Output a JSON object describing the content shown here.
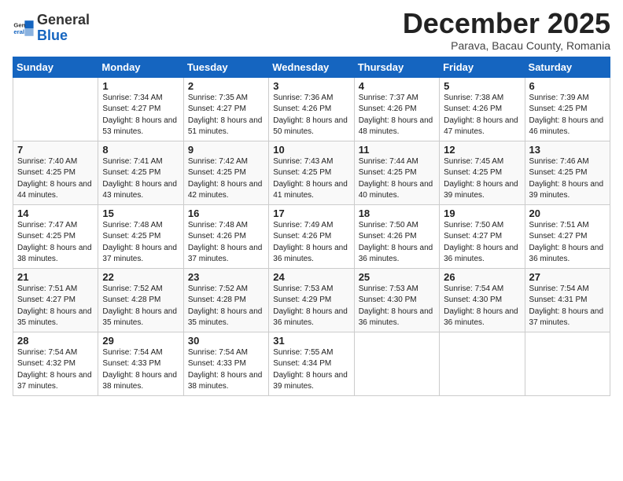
{
  "logo": {
    "general": "General",
    "blue": "Blue"
  },
  "header": {
    "month": "December 2025",
    "location": "Parava, Bacau County, Romania"
  },
  "weekdays": [
    "Sunday",
    "Monday",
    "Tuesday",
    "Wednesday",
    "Thursday",
    "Friday",
    "Saturday"
  ],
  "weeks": [
    [
      {
        "day": "",
        "sunrise": "",
        "sunset": "",
        "daylight": ""
      },
      {
        "day": "1",
        "sunrise": "Sunrise: 7:34 AM",
        "sunset": "Sunset: 4:27 PM",
        "daylight": "Daylight: 8 hours and 53 minutes."
      },
      {
        "day": "2",
        "sunrise": "Sunrise: 7:35 AM",
        "sunset": "Sunset: 4:27 PM",
        "daylight": "Daylight: 8 hours and 51 minutes."
      },
      {
        "day": "3",
        "sunrise": "Sunrise: 7:36 AM",
        "sunset": "Sunset: 4:26 PM",
        "daylight": "Daylight: 8 hours and 50 minutes."
      },
      {
        "day": "4",
        "sunrise": "Sunrise: 7:37 AM",
        "sunset": "Sunset: 4:26 PM",
        "daylight": "Daylight: 8 hours and 48 minutes."
      },
      {
        "day": "5",
        "sunrise": "Sunrise: 7:38 AM",
        "sunset": "Sunset: 4:26 PM",
        "daylight": "Daylight: 8 hours and 47 minutes."
      },
      {
        "day": "6",
        "sunrise": "Sunrise: 7:39 AM",
        "sunset": "Sunset: 4:25 PM",
        "daylight": "Daylight: 8 hours and 46 minutes."
      }
    ],
    [
      {
        "day": "7",
        "sunrise": "Sunrise: 7:40 AM",
        "sunset": "Sunset: 4:25 PM",
        "daylight": "Daylight: 8 hours and 44 minutes."
      },
      {
        "day": "8",
        "sunrise": "Sunrise: 7:41 AM",
        "sunset": "Sunset: 4:25 PM",
        "daylight": "Daylight: 8 hours and 43 minutes."
      },
      {
        "day": "9",
        "sunrise": "Sunrise: 7:42 AM",
        "sunset": "Sunset: 4:25 PM",
        "daylight": "Daylight: 8 hours and 42 minutes."
      },
      {
        "day": "10",
        "sunrise": "Sunrise: 7:43 AM",
        "sunset": "Sunset: 4:25 PM",
        "daylight": "Daylight: 8 hours and 41 minutes."
      },
      {
        "day": "11",
        "sunrise": "Sunrise: 7:44 AM",
        "sunset": "Sunset: 4:25 PM",
        "daylight": "Daylight: 8 hours and 40 minutes."
      },
      {
        "day": "12",
        "sunrise": "Sunrise: 7:45 AM",
        "sunset": "Sunset: 4:25 PM",
        "daylight": "Daylight: 8 hours and 39 minutes."
      },
      {
        "day": "13",
        "sunrise": "Sunrise: 7:46 AM",
        "sunset": "Sunset: 4:25 PM",
        "daylight": "Daylight: 8 hours and 39 minutes."
      }
    ],
    [
      {
        "day": "14",
        "sunrise": "Sunrise: 7:47 AM",
        "sunset": "Sunset: 4:25 PM",
        "daylight": "Daylight: 8 hours and 38 minutes."
      },
      {
        "day": "15",
        "sunrise": "Sunrise: 7:48 AM",
        "sunset": "Sunset: 4:25 PM",
        "daylight": "Daylight: 8 hours and 37 minutes."
      },
      {
        "day": "16",
        "sunrise": "Sunrise: 7:48 AM",
        "sunset": "Sunset: 4:26 PM",
        "daylight": "Daylight: 8 hours and 37 minutes."
      },
      {
        "day": "17",
        "sunrise": "Sunrise: 7:49 AM",
        "sunset": "Sunset: 4:26 PM",
        "daylight": "Daylight: 8 hours and 36 minutes."
      },
      {
        "day": "18",
        "sunrise": "Sunrise: 7:50 AM",
        "sunset": "Sunset: 4:26 PM",
        "daylight": "Daylight: 8 hours and 36 minutes."
      },
      {
        "day": "19",
        "sunrise": "Sunrise: 7:50 AM",
        "sunset": "Sunset: 4:27 PM",
        "daylight": "Daylight: 8 hours and 36 minutes."
      },
      {
        "day": "20",
        "sunrise": "Sunrise: 7:51 AM",
        "sunset": "Sunset: 4:27 PM",
        "daylight": "Daylight: 8 hours and 36 minutes."
      }
    ],
    [
      {
        "day": "21",
        "sunrise": "Sunrise: 7:51 AM",
        "sunset": "Sunset: 4:27 PM",
        "daylight": "Daylight: 8 hours and 35 minutes."
      },
      {
        "day": "22",
        "sunrise": "Sunrise: 7:52 AM",
        "sunset": "Sunset: 4:28 PM",
        "daylight": "Daylight: 8 hours and 35 minutes."
      },
      {
        "day": "23",
        "sunrise": "Sunrise: 7:52 AM",
        "sunset": "Sunset: 4:28 PM",
        "daylight": "Daylight: 8 hours and 35 minutes."
      },
      {
        "day": "24",
        "sunrise": "Sunrise: 7:53 AM",
        "sunset": "Sunset: 4:29 PM",
        "daylight": "Daylight: 8 hours and 36 minutes."
      },
      {
        "day": "25",
        "sunrise": "Sunrise: 7:53 AM",
        "sunset": "Sunset: 4:30 PM",
        "daylight": "Daylight: 8 hours and 36 minutes."
      },
      {
        "day": "26",
        "sunrise": "Sunrise: 7:54 AM",
        "sunset": "Sunset: 4:30 PM",
        "daylight": "Daylight: 8 hours and 36 minutes."
      },
      {
        "day": "27",
        "sunrise": "Sunrise: 7:54 AM",
        "sunset": "Sunset: 4:31 PM",
        "daylight": "Daylight: 8 hours and 37 minutes."
      }
    ],
    [
      {
        "day": "28",
        "sunrise": "Sunrise: 7:54 AM",
        "sunset": "Sunset: 4:32 PM",
        "daylight": "Daylight: 8 hours and 37 minutes."
      },
      {
        "day": "29",
        "sunrise": "Sunrise: 7:54 AM",
        "sunset": "Sunset: 4:33 PM",
        "daylight": "Daylight: 8 hours and 38 minutes."
      },
      {
        "day": "30",
        "sunrise": "Sunrise: 7:54 AM",
        "sunset": "Sunset: 4:33 PM",
        "daylight": "Daylight: 8 hours and 38 minutes."
      },
      {
        "day": "31",
        "sunrise": "Sunrise: 7:55 AM",
        "sunset": "Sunset: 4:34 PM",
        "daylight": "Daylight: 8 hours and 39 minutes."
      },
      {
        "day": "",
        "sunrise": "",
        "sunset": "",
        "daylight": ""
      },
      {
        "day": "",
        "sunrise": "",
        "sunset": "",
        "daylight": ""
      },
      {
        "day": "",
        "sunrise": "",
        "sunset": "",
        "daylight": ""
      }
    ]
  ]
}
